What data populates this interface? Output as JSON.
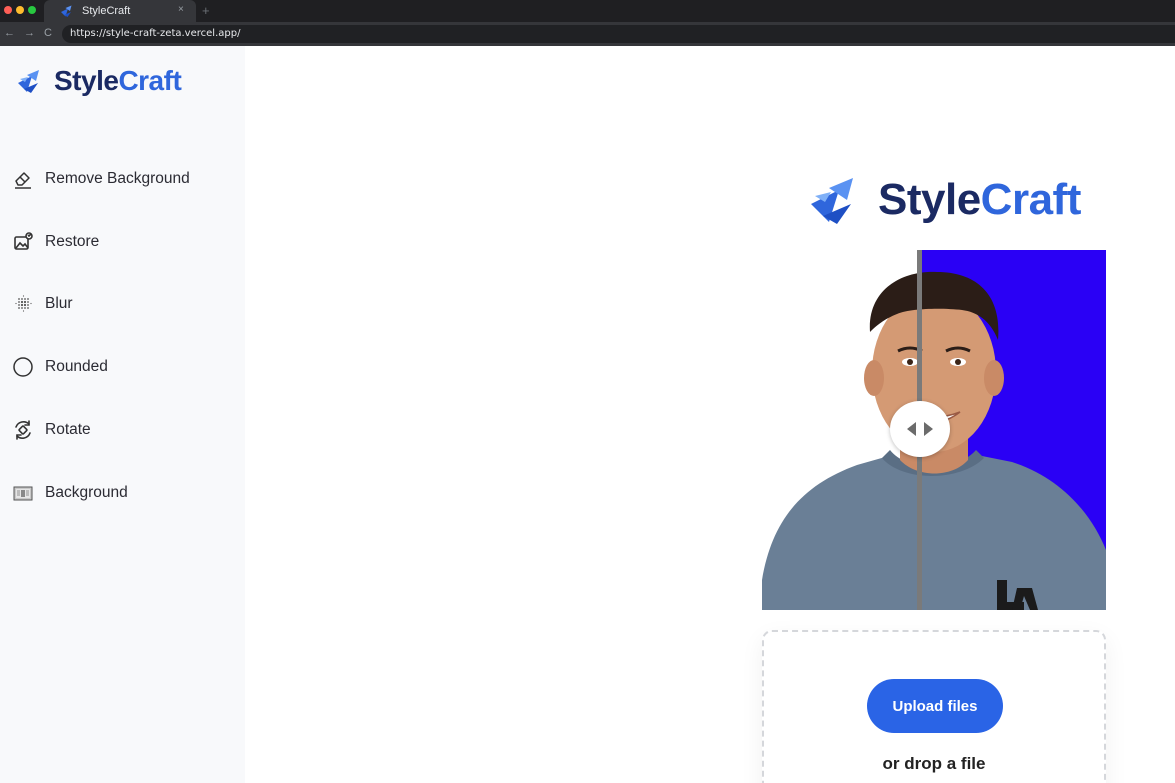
{
  "browser": {
    "tab_title": "StyleCraft",
    "tab_close": "×",
    "new_tab": "+",
    "url": "https://style-craft-zeta.vercel.app/",
    "back": "←",
    "forward": "→",
    "reload": "C"
  },
  "brand": {
    "part1": "Style",
    "part2": "Craft",
    "color_dark": "#1b2a63",
    "color_accent": "#2f66dc"
  },
  "sidebar": {
    "items": [
      {
        "label": "Remove Background",
        "icon": "eraser-icon"
      },
      {
        "label": "Restore",
        "icon": "image-restore-icon"
      },
      {
        "label": "Blur",
        "icon": "blur-grid-icon"
      },
      {
        "label": "Rounded",
        "icon": "circle-icon"
      },
      {
        "label": "Rotate",
        "icon": "rotate-icon"
      },
      {
        "label": "Background",
        "icon": "background-image-icon"
      }
    ]
  },
  "main": {
    "compare": {
      "left_background": "#ffffff",
      "right_background": "#2a00f5"
    },
    "upload": {
      "button_label": "Upload files",
      "drop_text": "or drop a file",
      "button_color": "#2a64e6"
    }
  }
}
